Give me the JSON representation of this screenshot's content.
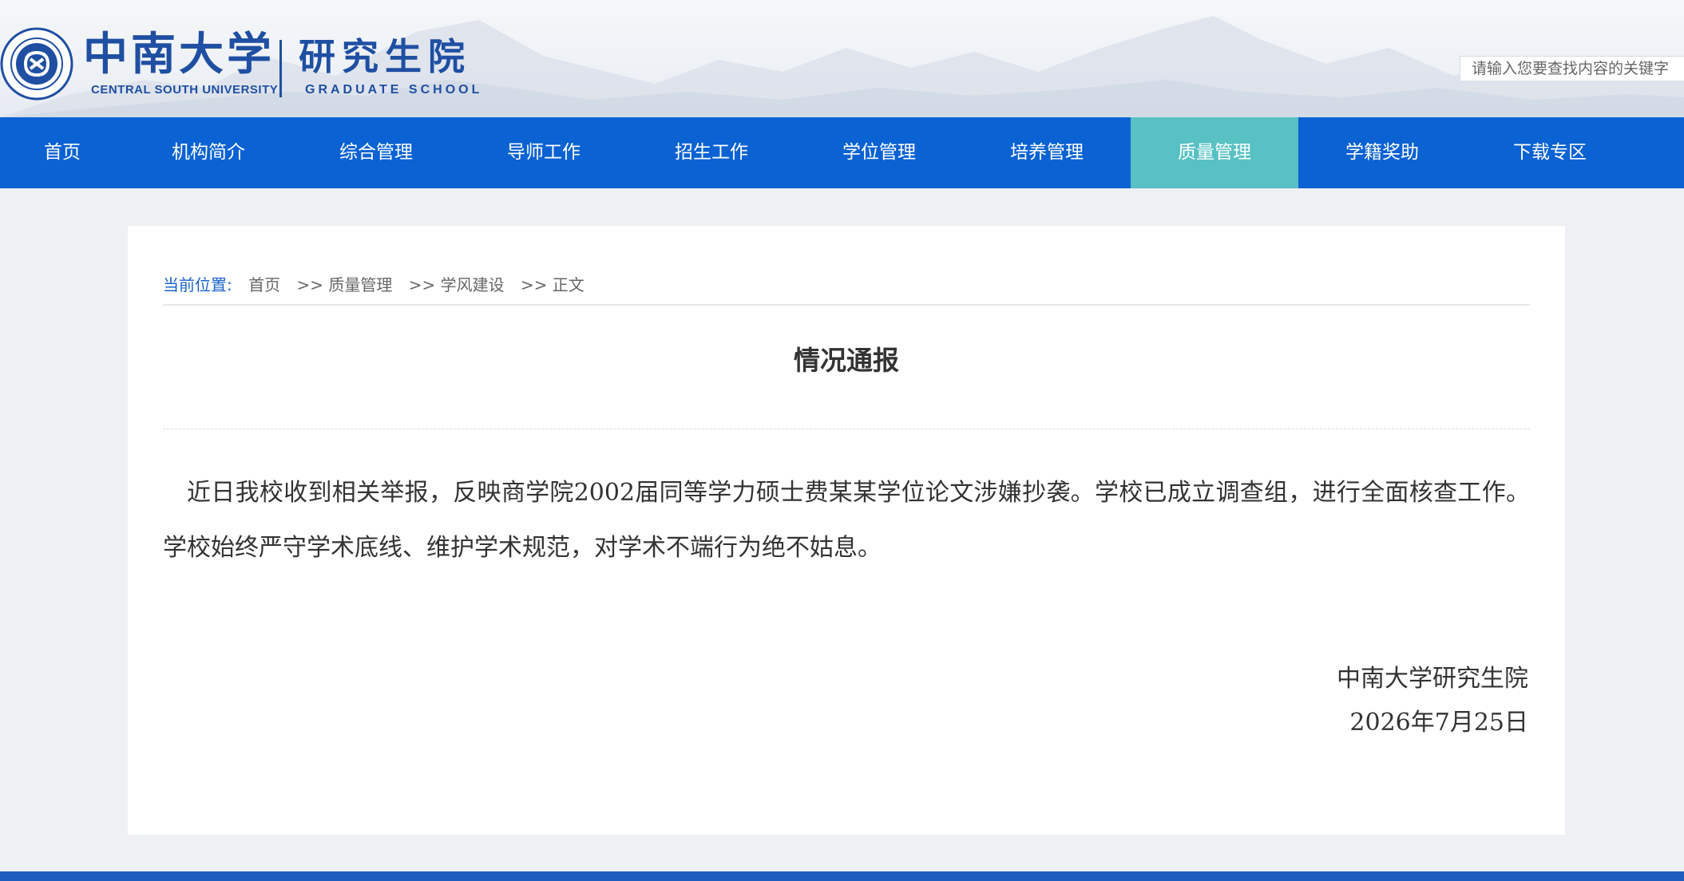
{
  "header": {
    "logo_cn": "中南大学",
    "logo_en": "CENTRAL SOUTH UNIVERSITY",
    "school_cn": "研究生院",
    "school_en": "GRADUATE SCHOOL",
    "search_placeholder": "请输入您要查找内容的关键字"
  },
  "nav": {
    "items": [
      {
        "label": "首页"
      },
      {
        "label": "机构简介"
      },
      {
        "label": "综合管理"
      },
      {
        "label": "导师工作"
      },
      {
        "label": "招生工作"
      },
      {
        "label": "学位管理"
      },
      {
        "label": "培养管理"
      },
      {
        "label": "质量管理",
        "active": true
      },
      {
        "label": "学籍奖助"
      },
      {
        "label": "下载专区"
      }
    ]
  },
  "breadcrumb": {
    "label": "当前位置:",
    "items": [
      "首页",
      ">> 质量管理",
      ">> 学风建设",
      ">> 正文"
    ]
  },
  "article": {
    "title": "情况通报",
    "body": "近日我校收到相关举报，反映商学院2002届同等学力硕士费某某学位论文涉嫌抄袭。学校已成立调查组，进行全面核查工作。学校始终严守学术底线、维护学术规范，对学术不端行为绝不姑息。",
    "signature_org": "中南大学研究生院",
    "signature_date": "2026年7月25日"
  },
  "colors": {
    "brand_blue": "#1f4fa2",
    "nav_blue": "#0a62d3",
    "nav_active": "#57c1c3",
    "breadcrumb_label": "#1a63c7"
  }
}
